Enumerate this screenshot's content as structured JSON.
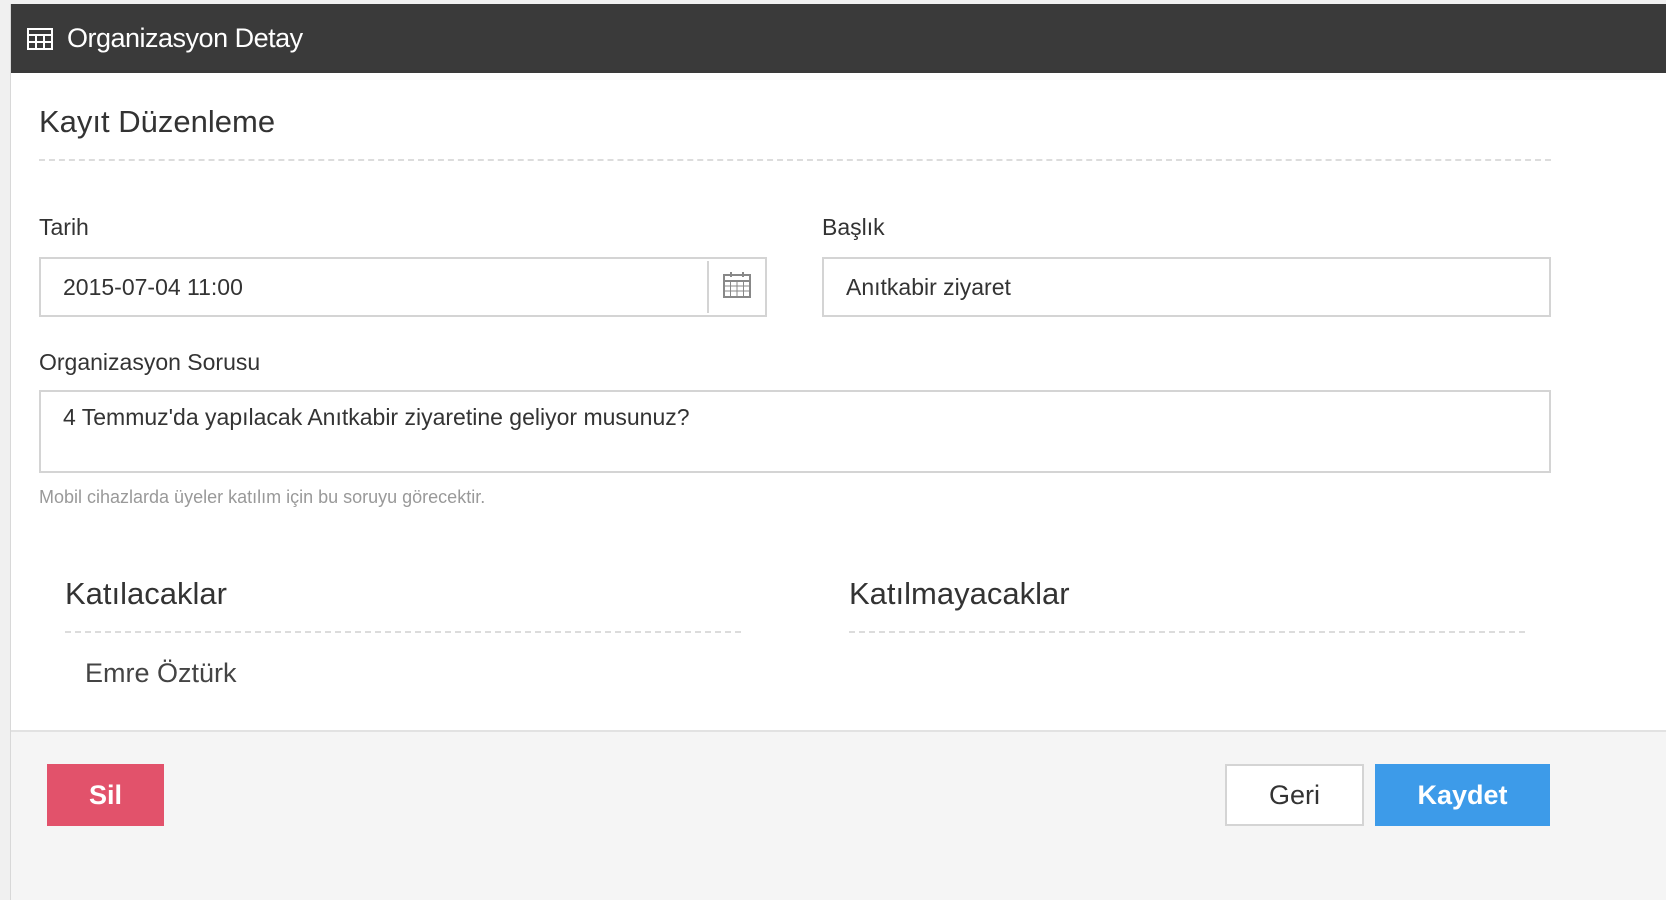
{
  "header": {
    "title": "Organizasyon Detay",
    "icon": "table-icon"
  },
  "form": {
    "section_title": "Kayıt Düzenleme",
    "date": {
      "label": "Tarih",
      "value": "2015-07-04 11:00",
      "icon": "calendar-icon"
    },
    "title_field": {
      "label": "Başlık",
      "value": "Anıtkabir ziyaret"
    },
    "question": {
      "label": "Organizasyon Sorusu",
      "value": "4 Temmuz'da yapılacak Anıtkabir ziyaretine geliyor musunuz?",
      "help": "Mobil cihazlarda üyeler katılım için bu soruyu görecektir."
    }
  },
  "attendees": {
    "attending_title": "Katılacaklar",
    "attending": [
      "Emre Öztürk"
    ],
    "not_attending_title": "Katılmayacaklar",
    "not_attending": []
  },
  "footer": {
    "delete_label": "Sil",
    "back_label": "Geri",
    "save_label": "Kaydet"
  },
  "colors": {
    "header_bg": "#3a3a3a",
    "danger": "#e2526b",
    "primary": "#3d9be9"
  }
}
